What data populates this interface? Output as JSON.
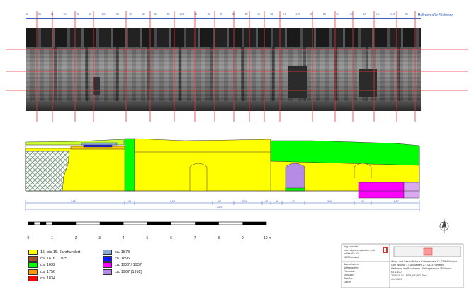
{
  "header": {
    "title": "Balkenmaße Südwand",
    "top_ruler": [
      "54",
      "53",
      "41",
      "52",
      "65",
      "55",
      "1,01",
      "60",
      "70",
      "56",
      "60",
      "86",
      "1,06",
      "68",
      "75",
      "65",
      "57",
      "69",
      "67",
      "55",
      "71",
      "1,00",
      "55",
      "84",
      "70",
      "1,01",
      "62",
      "1,07",
      "1,15",
      "54",
      "51"
    ]
  },
  "elevation": {
    "dimension_row_1": [
      "3,82",
      "45",
      "5,24",
      "62",
      "2,59",
      "42",
      "62",
      "79",
      "3,43",
      "95",
      "2,57"
    ],
    "dimension_total": "20,47"
  },
  "scale_bar": {
    "ticks": [
      "0",
      "1",
      "2",
      "3",
      "4",
      "5",
      "6",
      "7",
      "8",
      "9",
      "10 m"
    ]
  },
  "legend": {
    "items": [
      {
        "label": "15. bis 16. Jahrhundert",
        "color": "#ffff00"
      },
      {
        "label": "ca. 1616 / 1925",
        "color": "#a0522d"
      },
      {
        "label": "ca. 1692",
        "color": "#00ff00"
      },
      {
        "label": "ca. 1756",
        "color": "#ff9900"
      },
      {
        "label": "ca. 1834",
        "color": "#ff0000"
      },
      {
        "label": "ca. 1873",
        "color": "#87a9d6"
      },
      {
        "label": "ca. 1896",
        "color": "#1414ff"
      },
      {
        "label": "ca. 1927 / 1937",
        "color": "#ff00ff"
      },
      {
        "label": "ca. 1967 (1992)",
        "color": "#b48ce6"
      }
    ]
  },
  "title_block": {
    "author_lines": [
      "jörg schröder",
      "freier diplomrestaurator - vdr",
      "voßstraße 62",
      "18059 rostock"
    ],
    "field_labels": [
      "Bauvorhaben:",
      "Auftraggeber:",
      "Planinhalt:",
      "Maßstab:",
      "Plan-Nr.:",
      "Datum:"
    ],
    "field_values": [
      "Wohn- und Geschäftshaus Krämerstraße 15, 23966 Wismar",
      "GbR Wismar 1 / Apostelweg 2 / 22143 Hamburg",
      "Kartierung der Bauphasen - Kellergeschoss / Südwand",
      "ca. 1:100",
      "2009-10-01 - BPH_001 KG-Süd",
      "Juni 2009"
    ]
  },
  "colors": {
    "red_line": "#e8343a",
    "blue_text": "#3b5fc0",
    "yellow": "#ffff00",
    "green": "#00ff00",
    "magenta": "#ff00ff",
    "violet": "#b48ce6"
  }
}
